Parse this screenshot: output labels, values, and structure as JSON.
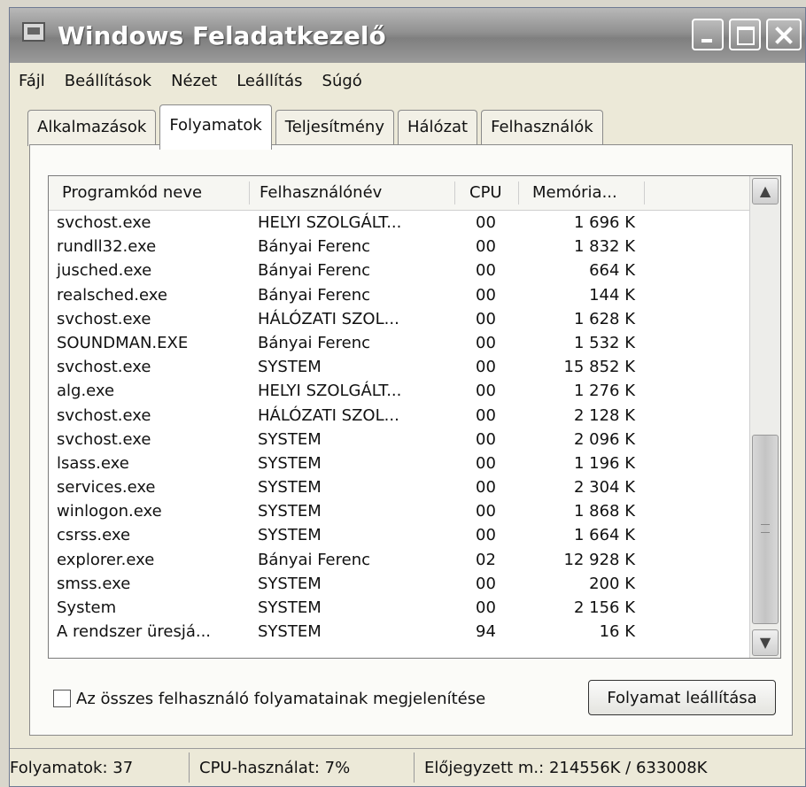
{
  "window": {
    "title": "Windows Feladatkezelő"
  },
  "menu": [
    "Fájl",
    "Beállítások",
    "Nézet",
    "Leállítás",
    "Súgó"
  ],
  "tabs": [
    {
      "label": "Alkalmazások",
      "active": false
    },
    {
      "label": "Folyamatok",
      "active": true
    },
    {
      "label": "Teljesítmény",
      "active": false
    },
    {
      "label": "Hálózat",
      "active": false
    },
    {
      "label": "Felhasználók",
      "active": false
    }
  ],
  "table": {
    "columns": {
      "name": "Programkód neve",
      "user": "Felhasználónév",
      "cpu": "CPU",
      "mem": "Memória..."
    },
    "rows": [
      {
        "name": "svchost.exe",
        "user": "HELYI SZOLGÁLT...",
        "cpu": "00",
        "mem": "1 696 K"
      },
      {
        "name": "rundll32.exe",
        "user": "Bányai Ferenc",
        "cpu": "00",
        "mem": "1 832 K"
      },
      {
        "name": "jusched.exe",
        "user": "Bányai Ferenc",
        "cpu": "00",
        "mem": "664 K"
      },
      {
        "name": "realsched.exe",
        "user": "Bányai Ferenc",
        "cpu": "00",
        "mem": "144 K"
      },
      {
        "name": "svchost.exe",
        "user": "HÁLÓZATI SZOL...",
        "cpu": "00",
        "mem": "1 628 K"
      },
      {
        "name": "SOUNDMAN.EXE",
        "user": "Bányai Ferenc",
        "cpu": "00",
        "mem": "1 532 K"
      },
      {
        "name": "svchost.exe",
        "user": "SYSTEM",
        "cpu": "00",
        "mem": "15 852 K"
      },
      {
        "name": "alg.exe",
        "user": "HELYI SZOLGÁLT...",
        "cpu": "00",
        "mem": "1 276 K"
      },
      {
        "name": "svchost.exe",
        "user": "HÁLÓZATI SZOL...",
        "cpu": "00",
        "mem": "2 128 K"
      },
      {
        "name": "svchost.exe",
        "user": "SYSTEM",
        "cpu": "00",
        "mem": "2 096 K"
      },
      {
        "name": "lsass.exe",
        "user": "SYSTEM",
        "cpu": "00",
        "mem": "1 196 K"
      },
      {
        "name": "services.exe",
        "user": "SYSTEM",
        "cpu": "00",
        "mem": "2 304 K"
      },
      {
        "name": "winlogon.exe",
        "user": "SYSTEM",
        "cpu": "00",
        "mem": "1 868 K"
      },
      {
        "name": "csrss.exe",
        "user": "SYSTEM",
        "cpu": "00",
        "mem": "1 664 K"
      },
      {
        "name": "explorer.exe",
        "user": "Bányai Ferenc",
        "cpu": "02",
        "mem": "12 928 K"
      },
      {
        "name": "smss.exe",
        "user": "SYSTEM",
        "cpu": "00",
        "mem": "200 K"
      },
      {
        "name": "System",
        "user": "SYSTEM",
        "cpu": "00",
        "mem": "2 156 K"
      },
      {
        "name": "A rendszer üresjá...",
        "user": "SYSTEM",
        "cpu": "94",
        "mem": "16 K"
      }
    ]
  },
  "show_all_users": {
    "label": "Az összes felhasználó folyamatainak megjelenítése",
    "checked": false
  },
  "end_process_button": "Folyamat leállítása",
  "status": {
    "processes": "Folyamatok: 37",
    "cpu": "CPU-használat: 7%",
    "commit": "Előjegyzett m.: 214556K / 633008K"
  }
}
